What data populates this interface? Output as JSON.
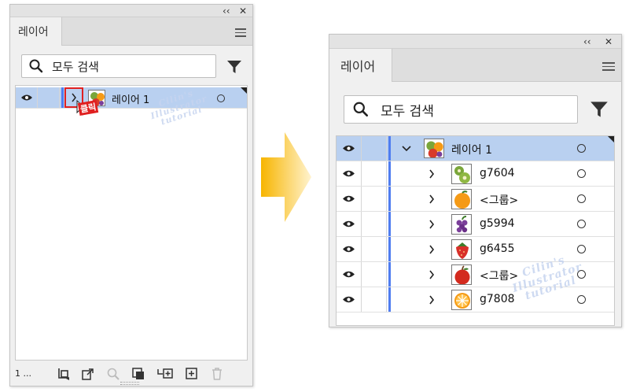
{
  "panel_controls": {
    "collapse": "‹‹",
    "close": "✕"
  },
  "panel": {
    "tab_label": "레이어",
    "search_placeholder": "모두 검색"
  },
  "left": {
    "row": {
      "name": "레이어 1"
    },
    "click_label": "클릭",
    "layer_count": "1 ...",
    "watermark": [
      "Cilin's",
      "Illustrator",
      "tutorial"
    ]
  },
  "right": {
    "rows": [
      {
        "name": "레이어 1",
        "expanded": true,
        "icon": "mixed-fruit-thumbnail"
      },
      {
        "name": "g7604",
        "icon": "kiwi-thumbnail"
      },
      {
        "name": "<그룹>",
        "icon": "orange-thumbnail"
      },
      {
        "name": "g5994",
        "icon": "grapes-thumbnail"
      },
      {
        "name": "g6455",
        "icon": "strawberry-thumbnail"
      },
      {
        "name": "<그룹>",
        "icon": "apple-thumbnail"
      },
      {
        "name": "g7808",
        "icon": "orange-slice-thumbnail"
      }
    ],
    "watermark": [
      "Cilin's",
      "Illustrator",
      "tutorial"
    ]
  },
  "colors": {
    "selection": "#b9d0f0",
    "layer_color": "#4f7df0",
    "arrow_gradient": [
      "#f7b500",
      "#fff1c4"
    ],
    "click_highlight": "#e02020"
  }
}
